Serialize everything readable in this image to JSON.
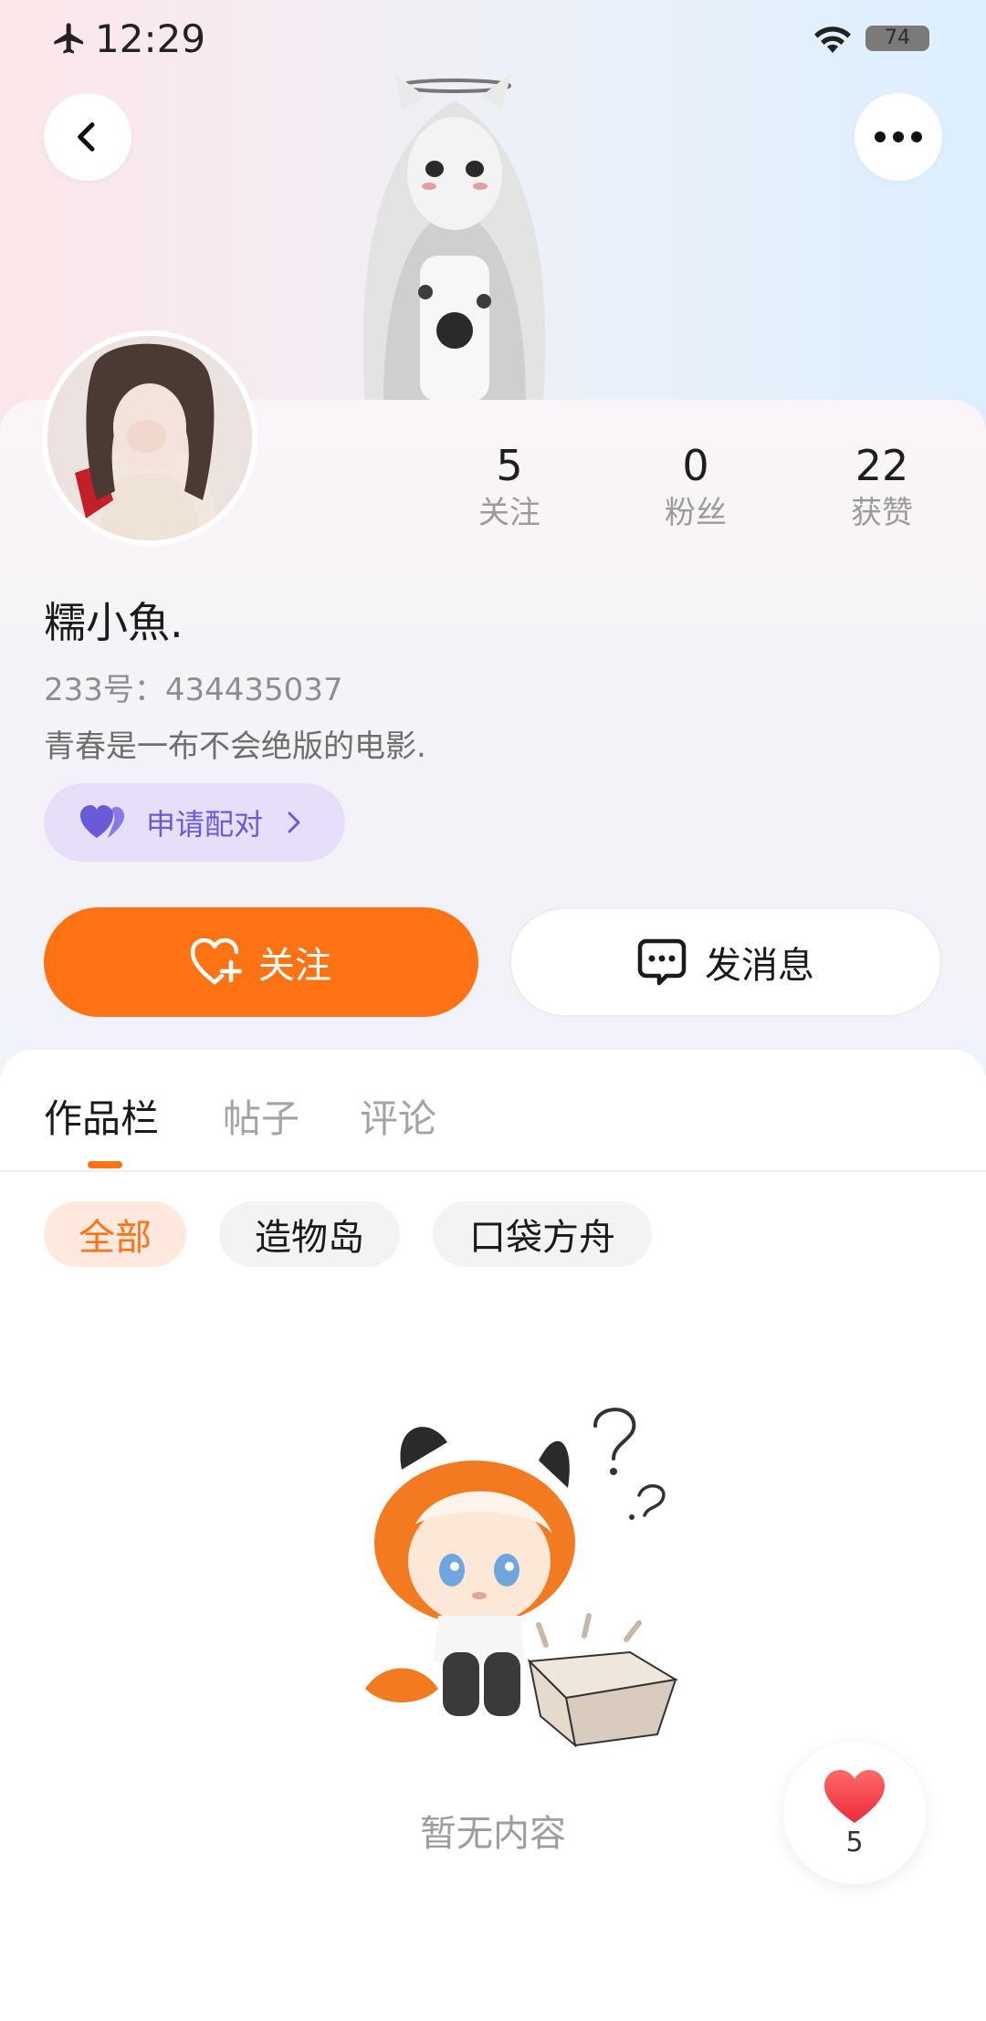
{
  "status_bar": {
    "time": "12:29",
    "battery": "74"
  },
  "profile": {
    "nickname": "糯小魚.",
    "uid": "233号：434435037",
    "bio": "青春是一布不会绝版的电影."
  },
  "stats": [
    {
      "value": "5",
      "label": "关注"
    },
    {
      "value": "0",
      "label": "粉丝"
    },
    {
      "value": "22",
      "label": "获赞"
    }
  ],
  "pair_button": {
    "label": "申请配对"
  },
  "actions": {
    "follow_label": "关注",
    "message_label": "发消息"
  },
  "tabs": [
    {
      "label": "作品栏",
      "active": true
    },
    {
      "label": "帖子",
      "active": false
    },
    {
      "label": "评论",
      "active": false
    }
  ],
  "filters": [
    {
      "label": "全部",
      "active": true
    },
    {
      "label": "造物岛",
      "active": false
    },
    {
      "label": "口袋方舟",
      "active": false
    }
  ],
  "empty_state": {
    "text": "暂无内容"
  },
  "like_fab": {
    "count": "5"
  },
  "colors": {
    "accent": "#ff7314",
    "pair": "#6a5ad6",
    "pair_bg": "#e7defa"
  }
}
